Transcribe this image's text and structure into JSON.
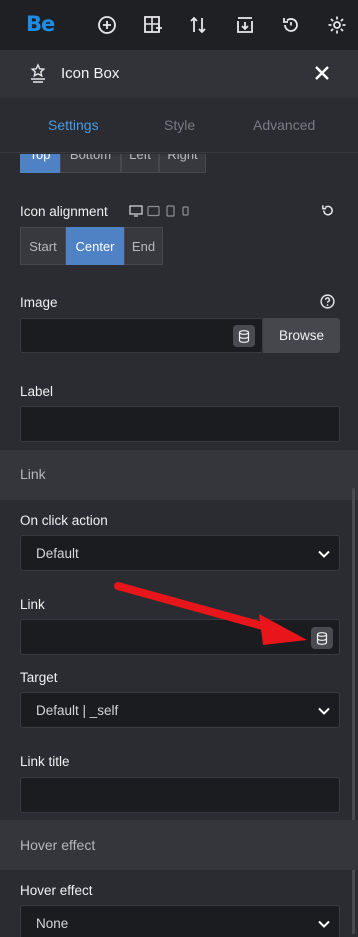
{
  "toolbar": {
    "logo": "Be",
    "icons": [
      "add-icon",
      "add-section-icon",
      "sort-icon",
      "import-icon",
      "history-icon",
      "settings-icon"
    ]
  },
  "panel": {
    "title": "Icon Box",
    "icon": "star-podium-icon"
  },
  "tabs": [
    {
      "label": "Settings",
      "active": true
    },
    {
      "label": "Style",
      "active": false
    },
    {
      "label": "Advanced",
      "active": false
    }
  ],
  "position_group": {
    "options": [
      "Top",
      "Bottom",
      "Left",
      "Right"
    ],
    "selected": "Top"
  },
  "icon_alignment": {
    "label": "Icon alignment",
    "options": [
      "Start",
      "Center",
      "End"
    ],
    "selected": "Center"
  },
  "image": {
    "label": "Image",
    "value": "",
    "browse_label": "Browse"
  },
  "label_field": {
    "label": "Label",
    "value": ""
  },
  "link_section": {
    "title": "Link"
  },
  "on_click": {
    "label": "On click action",
    "value": "Default"
  },
  "link": {
    "label": "Link",
    "value": ""
  },
  "target": {
    "label": "Target",
    "value": "Default | _self"
  },
  "link_title": {
    "label": "Link title",
    "value": ""
  },
  "hover_section": {
    "title": "Hover effect"
  },
  "hover_effect": {
    "label": "Hover effect",
    "value": "None"
  },
  "colors": {
    "accent": "#4f82c4",
    "brand": "#1e8de6",
    "annotation_arrow": "#e8151b"
  }
}
